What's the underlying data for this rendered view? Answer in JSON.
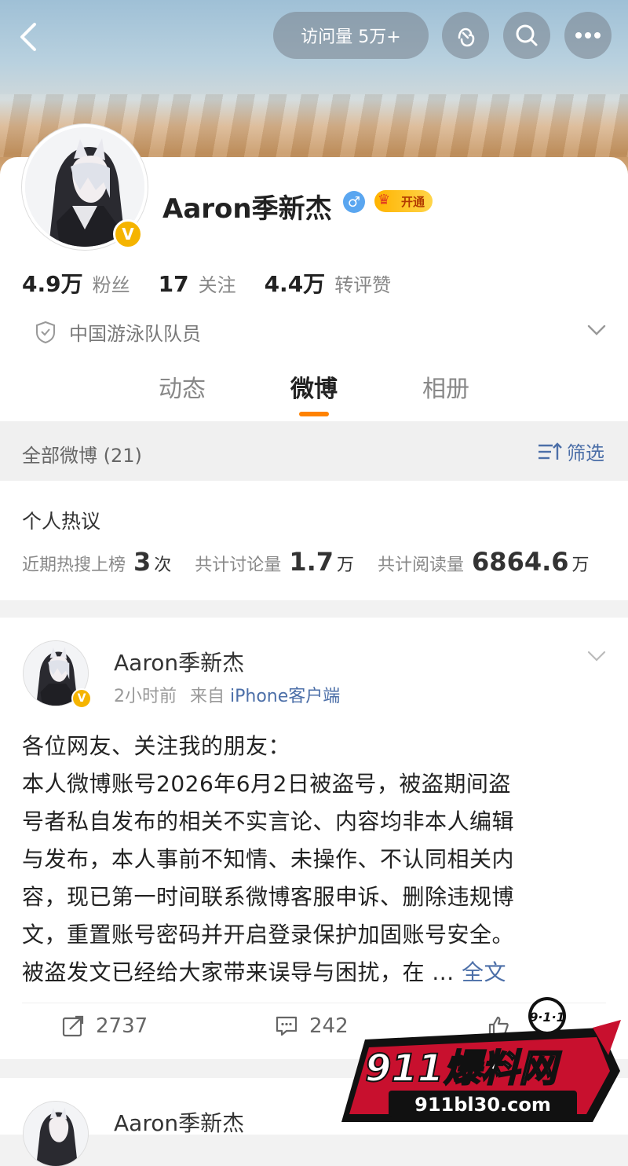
{
  "header": {
    "visits_label": "访问量 5万+",
    "buttons": [
      "back-icon",
      "gesture-icon",
      "search-icon",
      "more-icon"
    ]
  },
  "profile": {
    "name": "Aaron季新杰",
    "vip_label": "开通",
    "stats": [
      {
        "value": "4.9万",
        "label": "粉丝"
      },
      {
        "value": "17",
        "label": "关注"
      },
      {
        "value": "4.4万",
        "label": "转评赞"
      }
    ],
    "certification": "中国游泳队队员"
  },
  "tabs": [
    {
      "label": "动态",
      "active": false
    },
    {
      "label": "微博",
      "active": true
    },
    {
      "label": "相册",
      "active": false
    }
  ],
  "filterbar": {
    "all_label": "全部微博 (21)",
    "filter_label": "筛选"
  },
  "hot": {
    "title": "个人热议",
    "items": [
      {
        "label": "近期热搜上榜",
        "value": "3",
        "unit": "次"
      },
      {
        "label": "共计讨论量",
        "value": "1.7",
        "unit": "万"
      },
      {
        "label": "共计阅读量",
        "value": "6864.6",
        "unit": "万"
      }
    ]
  },
  "post": {
    "author": "Aaron季新杰",
    "time": "2小时前",
    "from_prefix": "来自",
    "source": "iPhone客户端",
    "lines": [
      "各位网友、关注我的朋友：",
      "本人微博账号2026年6月2日被盗号，被盗期间盗",
      "号者私自发布的相关不实言论、内容均非本人编辑",
      "与发布，本人事前不知情、未操作、不认同相关内",
      "容，现已第一时间联系微博客服申诉、删除违规博",
      "文，重置账号密码并开启登录保护加固账号安全。",
      "被盗发文已经给大家带来误导与困扰，在 ..."
    ],
    "more_label": "全文",
    "repost_count": "2737",
    "comment_count": "242"
  },
  "post2": {
    "author": "Aaron季新杰"
  },
  "watermark": {
    "badge": "9·1·1",
    "title": "911爆料网",
    "url": "911bl30.com"
  },
  "colors": {
    "accent": "#ff8200",
    "link": "#4c6fa8",
    "verified": "#f5b400"
  }
}
